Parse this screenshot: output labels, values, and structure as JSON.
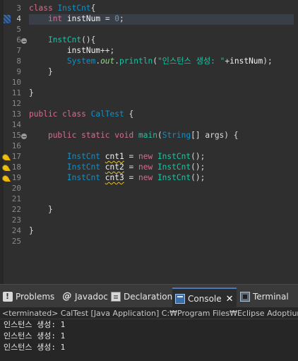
{
  "editor": {
    "line_numbers": [
      "3",
      "4",
      "5",
      "6",
      "7",
      "8",
      "9",
      "10",
      "11",
      "12",
      "13",
      "14",
      "15",
      "16",
      "17",
      "18",
      "19",
      "20",
      "21",
      "22",
      "23",
      "24",
      "25"
    ],
    "current_line": "4",
    "code": {
      "l3": {
        "kw": "class",
        "name": "InstCnt",
        "brace": "{"
      },
      "l4": {
        "type": "int",
        "field": "instNum",
        "rest": " = ",
        "num": "0",
        "semi": ";"
      },
      "l6": {
        "ctor": "InstCnt",
        "rest": "(){"
      },
      "l7": {
        "field": "instNum",
        "rest": "++;"
      },
      "l8": {
        "sys": "System",
        "dot1": ".",
        "out": "out",
        "dot2": ".",
        "method": "println",
        "open": "(",
        "str": "\"인스턴스 생성: \"",
        "plus": "+",
        "field": "instNum",
        "close": ");"
      },
      "l9": {
        "brace": "}"
      },
      "l11": {
        "brace": "}"
      },
      "l13": {
        "kw1": "public",
        "kw2": "class",
        "name": "CalTest",
        "brace": " {"
      },
      "l15": {
        "kw1": "public",
        "kw2": "static",
        "kw3": "void",
        "method": "main",
        "open": "(",
        "type": "String",
        "arr": "[] ",
        "param": "args",
        "close": ") {"
      },
      "l17": {
        "type": "InstCnt",
        "var": "cnt1",
        "eq": " = ",
        "kw": "new",
        "ctor": "InstCnt",
        "rest": "();"
      },
      "l18": {
        "type": "InstCnt",
        "var": "cnt2",
        "eq": " = ",
        "kw": "new",
        "ctor": "InstCnt",
        "rest": "();"
      },
      "l19": {
        "type": "InstCnt",
        "var": "cnt3",
        "eq": " = ",
        "kw": "new",
        "ctor": "InstCnt",
        "rest": "();"
      },
      "l22": {
        "brace": "}"
      },
      "l24": {
        "brace": "}"
      }
    }
  },
  "console_view": {
    "tabs": [
      {
        "label": "Problems",
        "icon": "problems-icon"
      },
      {
        "label": "Javadoc",
        "icon": "javadoc-icon",
        "glyph": "@"
      },
      {
        "label": "Declaration",
        "icon": "declaration-icon"
      },
      {
        "label": "Console",
        "icon": "console-icon",
        "active": true,
        "close": "✕"
      },
      {
        "label": "Terminal",
        "icon": "terminal-icon"
      }
    ],
    "status": "<terminated> CalTest [Java Application] C:₩Program Files₩Eclipse Adoptium₩",
    "output": [
      "인스턴스 생성: 1",
      "인스턴스 생성: 1",
      "인스턴스 생성: 1"
    ]
  },
  "colors": {
    "editor_bg": "#2f2f2f",
    "keyword": "#d76d8a",
    "type": "#1290c3",
    "field": "#66e1f8",
    "string": "#17c6a3",
    "console_bg": "#262626",
    "active_tab_accent": "#4b78b8"
  }
}
